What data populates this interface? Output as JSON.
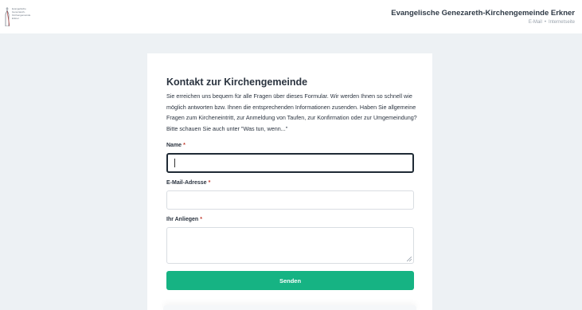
{
  "header": {
    "logo_lines": [
      "Evangelische",
      "Genezareth-",
      "Kirchengemeinde",
      "Erkner"
    ],
    "title": "Evangelische Genezareth-Kirchengemeinde Erkner",
    "links": [
      "E-Mail",
      "Internetseite"
    ],
    "separator": "•"
  },
  "form": {
    "title": "Kontakt zur Kirchengemeinde",
    "intro": "Sie erreichen uns bequem für alle Fragen über dieses Formular. Wir werden Ihnen so schnell wie möglich antworten bzw. Ihnen die entsprechenden Informationen zusenden. Haben Sie allgemeine Fragen zum Kircheneintritt, zur Anmeldung von Taufen, zur Konfirmation oder zur Umgemeindung? Bitte schauen Sie auch unter \"Was tun, wenn...\"",
    "name_label": "Name",
    "email_label": "E-Mail-Adresse",
    "message_label": "Ihr Anliegen",
    "required_marker": "*",
    "name_value": "",
    "email_value": "",
    "message_value": "",
    "submit_label": "Senden"
  },
  "colors": {
    "background": "#edf1f4",
    "accent": "#16b383",
    "required": "#c0392b"
  },
  "icons": {
    "logo": "church-logo-icon",
    "resize": "resize-handle-icon"
  }
}
